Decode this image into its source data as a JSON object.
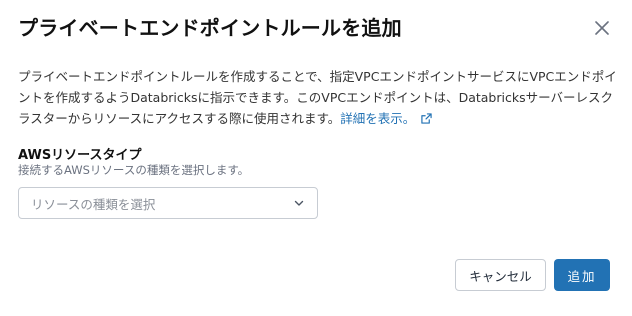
{
  "dialog": {
    "title": "プライベートエンドポイントルールを追加",
    "close_icon": "close-icon",
    "description": "プライベートエンドポイントルールを作成することで、指定VPCエンドポイントサービスにVPCエンドポイントを作成するようDatabricksに指示できます。このVPCエンドポイントは、Databricksサーバーレスクラスターからリソースにアクセスする際に使用されます。",
    "learn_more_link": "詳細を表示。",
    "external_link_icon": "external-link-icon"
  },
  "form": {
    "resource_type_label": "AWSリソースタイプ",
    "resource_type_help": "接続するAWSリソースの種類を選択します。",
    "resource_type_placeholder": "リソースの種類を選択",
    "chevron_icon": "chevron-down-icon"
  },
  "footer": {
    "cancel_label": "キャンセル",
    "add_label": "追加"
  },
  "colors": {
    "primary": "#2272b4",
    "border": "#c7ccd3",
    "link": "#2272b4"
  }
}
